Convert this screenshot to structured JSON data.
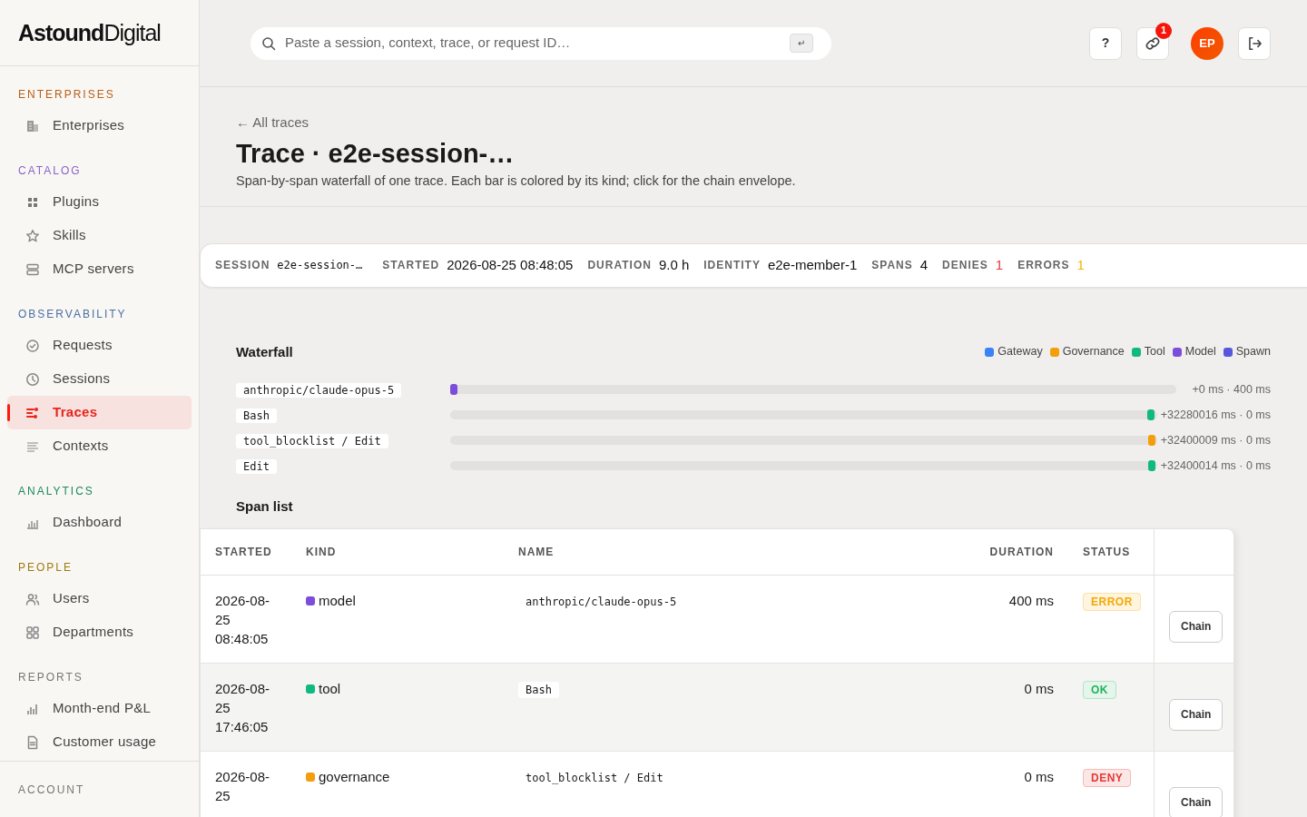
{
  "brand": {
    "bold": "Astound",
    "light": "Digital"
  },
  "sidebar": {
    "sections": [
      {
        "title": "ENTERPRISES",
        "color": "#b8601a",
        "items": [
          {
            "label": "Enterprises",
            "selected": false
          }
        ]
      },
      {
        "title": "CATALOG",
        "color": "#8a63c9",
        "items": [
          {
            "label": "Plugins",
            "selected": false
          },
          {
            "label": "Skills",
            "selected": false
          },
          {
            "label": "MCP servers",
            "selected": false
          }
        ]
      },
      {
        "title": "OBSERVABILITY",
        "color": "#4a6fa5",
        "items": [
          {
            "label": "Requests",
            "selected": false
          },
          {
            "label": "Sessions",
            "selected": false
          },
          {
            "label": "Traces",
            "selected": true
          },
          {
            "label": "Contexts",
            "selected": false
          }
        ]
      },
      {
        "title": "ANALYTICS",
        "color": "#1e8a5a",
        "items": [
          {
            "label": "Dashboard",
            "selected": false
          }
        ]
      },
      {
        "title": "PEOPLE",
        "color": "#a07a10",
        "items": [
          {
            "label": "Users",
            "selected": false
          },
          {
            "label": "Departments",
            "selected": false
          }
        ]
      },
      {
        "title": "REPORTS",
        "color": "#777777",
        "items": [
          {
            "label": "Month-end P&L",
            "selected": false
          },
          {
            "label": "Customer usage",
            "selected": false
          }
        ]
      },
      {
        "title": "ACCOUNT",
        "color": "#777777"
      }
    ]
  },
  "topbar": {
    "search": {
      "placeholder": "Paste a session, context, trace, or request ID…",
      "key": "↵"
    },
    "help": "?",
    "link_badge": "1",
    "avatar": "EP"
  },
  "header": {
    "back": "← All traces",
    "title": "Trace · e2e-session-…",
    "subtitle": "Span-by-span waterfall of one trace. Each bar is colored by its kind; click for the chain envelope."
  },
  "summary": [
    {
      "label": "SESSION",
      "value": "e2e-session-…",
      "kind": "mono"
    },
    {
      "label": "STARTED",
      "value": "2026-08-25 08:48:05",
      "kind": "plain"
    },
    {
      "label": "DURATION",
      "value": "9.0 h",
      "kind": "plain"
    },
    {
      "label": "IDENTITY",
      "value": "e2e-member-1",
      "kind": "plain"
    },
    {
      "label": "SPANS",
      "value": "4",
      "kind": "plain"
    },
    {
      "label": "DENIES",
      "value": "1",
      "kind": "danger"
    },
    {
      "label": "ERRORS",
      "value": "1",
      "kind": "warning"
    }
  ],
  "waterfall": {
    "title": "Waterfall",
    "legend": [
      {
        "label": "Gateway",
        "color": "#3b82f6"
      },
      {
        "label": "Governance",
        "color": "#f59e0b"
      },
      {
        "label": "Tool",
        "color": "#10b981"
      },
      {
        "label": "Model",
        "color": "#7c4ddb"
      },
      {
        "label": "Spawn",
        "color": "#5558dd"
      }
    ],
    "rows": [
      {
        "name": "anthropic/claude-opus-5",
        "color": "#7c4ddb",
        "level": 0,
        "reading": "+0 ms · 400 ms"
      },
      {
        "name": "Bash",
        "color": "#10b981",
        "level": 0.9965,
        "reading": "+32280016 ms · 0 ms"
      },
      {
        "name": "tool_blocklist / Edit",
        "color": "#f59e0b",
        "level": 0.998,
        "reading": "+32400009 ms · 0 ms"
      },
      {
        "name": "Edit",
        "color": "#10b981",
        "level": 0.998,
        "reading": "+32400014 ms · 0 ms"
      }
    ]
  },
  "span_list": {
    "title": "Span list",
    "columns": [
      "STARTED",
      "KIND",
      "NAME",
      "DURATION",
      "STATUS"
    ],
    "rows": [
      {
        "started": "2026-08-25 08:48:05",
        "kind": "model",
        "color": "#7c4ddb",
        "name": "anthropic/claude-opus-5",
        "duration": "400 ms",
        "status": {
          "label": "ERROR",
          "color": "#f5a800"
        },
        "highlighted": false,
        "action": "Chain"
      },
      {
        "started": "2026-08-25 17:46:05",
        "kind": "tool",
        "color": "#10b981",
        "name": "Bash",
        "duration": "0 ms",
        "status": {
          "label": "OK",
          "color": "#22b35a"
        },
        "highlighted": true,
        "action": "Chain"
      },
      {
        "started": "2026-08-25",
        "kind": "governance",
        "color": "#f59e0b",
        "name": "tool_blocklist / Edit",
        "duration": "0 ms",
        "status": {
          "label": "DENY",
          "color": "#e53935"
        },
        "highlighted": false,
        "action": "Chain"
      }
    ]
  }
}
